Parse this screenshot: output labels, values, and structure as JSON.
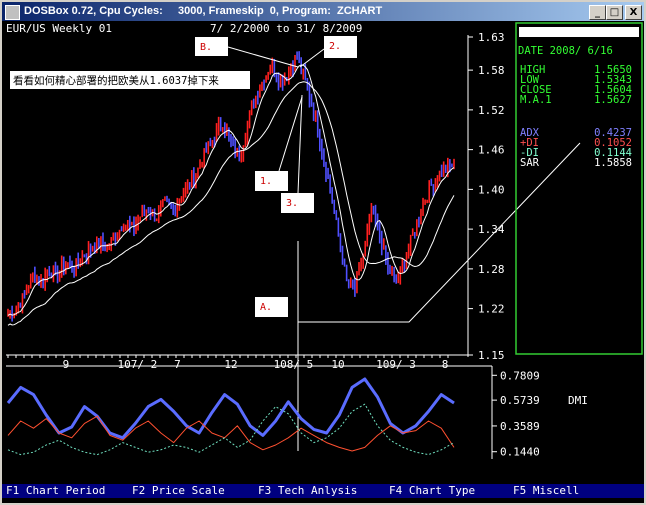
{
  "window": {
    "title": "DOSBox 0.72, Cpu Cycles:     3000, Frameskip  0, Program:  ZCHART",
    "buttons": [
      "_",
      "□",
      "X"
    ]
  },
  "chart_header": {
    "symbol": "EUR/US Weekly 01",
    "range": "7/ 2/2000 to 31/ 8/2009"
  },
  "annotation_cn": "看看如何精心部署的把欧美从1.6037掉下来",
  "labels": {
    "B": "B.",
    "two": "2.",
    "one": "1.",
    "three": "3.",
    "A": "A."
  },
  "info_panel": {
    "date": "DATE 2008/ 6/16",
    "rows": [
      {
        "k": "HIGH",
        "v": "1.5650",
        "color": "#33ff33"
      },
      {
        "k": "LOW",
        "v": "1.5343",
        "color": "#33ff33"
      },
      {
        "k": "CLOSE",
        "v": "1.5604",
        "color": "#33ff33"
      },
      {
        "k": "M.A.1",
        "v": "1.5627",
        "color": "#33ff33"
      }
    ],
    "rows2": [
      {
        "k": "ADX",
        "v": "0.4237",
        "color": "#8080ff"
      },
      {
        "k": "+DI",
        "v": "0.1052",
        "color": "#ff5050"
      },
      {
        "k": "-DI",
        "v": "0.1144",
        "color": "#80ffd0"
      },
      {
        "k": "SAR",
        "v": "1.5858",
        "color": "#ffffff"
      }
    ]
  },
  "dmi_label": "DMI",
  "function_keys": [
    "F1 Chart Period",
    "F2 Price Scale",
    "F3 Tech Anlysis",
    "F4 Chart Type",
    "F5 Miscell"
  ],
  "colors": {
    "up_bar": "#ff2020",
    "down_bar": "#5050ff",
    "ma": "#ffffff",
    "panel_border": "#33cc33"
  },
  "chart_data": [
    {
      "type": "line",
      "title": "EUR/US Weekly 01",
      "y_ticks": [
        "1.63",
        "1.58",
        "1.52",
        "1.46",
        "1.40",
        "1.34",
        "1.28",
        "1.22",
        "1.15"
      ],
      "ylim": [
        1.15,
        1.63
      ],
      "x_ticks": [
        "9",
        "107/ 2",
        "7",
        "12",
        "108/ 5",
        "10",
        "109/ 3",
        "8"
      ],
      "series": [
        {
          "values": [
            1.21,
            1.22,
            1.24,
            1.27,
            1.26,
            1.28,
            1.27,
            1.29,
            1.28,
            1.3,
            1.31,
            1.32,
            1.31,
            1.33,
            1.35,
            1.34,
            1.36,
            1.37,
            1.36,
            1.38,
            1.37,
            1.39,
            1.41,
            1.43,
            1.46,
            1.48,
            1.5,
            1.47,
            1.45,
            1.5,
            1.54,
            1.57,
            1.59,
            1.56,
            1.58,
            1.6,
            1.56,
            1.52,
            1.46,
            1.4,
            1.33,
            1.26,
            1.25,
            1.3,
            1.37,
            1.33,
            1.28,
            1.26,
            1.29,
            1.33,
            1.37,
            1.4,
            1.42,
            1.43,
            1.44
          ]
        }
      ]
    },
    {
      "type": "line",
      "title": "DMI",
      "y_ticks": [
        "0.7809",
        "0.5739",
        "0.3589",
        "0.1440"
      ],
      "ylim": [
        0.1,
        0.8
      ],
      "series": [
        {
          "name": "ADX",
          "values": [
            0.55,
            0.68,
            0.62,
            0.45,
            0.3,
            0.35,
            0.52,
            0.44,
            0.3,
            0.26,
            0.38,
            0.52,
            0.58,
            0.48,
            0.36,
            0.3,
            0.47,
            0.62,
            0.54,
            0.36,
            0.28,
            0.4,
            0.56,
            0.42,
            0.33,
            0.3,
            0.45,
            0.68,
            0.75,
            0.6,
            0.38,
            0.3,
            0.36,
            0.48,
            0.62,
            0.55
          ]
        },
        {
          "name": "+DI",
          "values": [
            0.28,
            0.4,
            0.34,
            0.42,
            0.3,
            0.26,
            0.38,
            0.44,
            0.28,
            0.24,
            0.34,
            0.4,
            0.3,
            0.22,
            0.34,
            0.4,
            0.3,
            0.26,
            0.36,
            0.22,
            0.16,
            0.2,
            0.26,
            0.34,
            0.28,
            0.22,
            0.18,
            0.15,
            0.18,
            0.28,
            0.36,
            0.3,
            0.32,
            0.4,
            0.34,
            0.18
          ]
        },
        {
          "name": "-DI",
          "values": [
            0.16,
            0.12,
            0.14,
            0.2,
            0.24,
            0.18,
            0.14,
            0.12,
            0.16,
            0.22,
            0.18,
            0.14,
            0.16,
            0.2,
            0.18,
            0.14,
            0.2,
            0.26,
            0.18,
            0.24,
            0.4,
            0.52,
            0.46,
            0.3,
            0.22,
            0.26,
            0.34,
            0.48,
            0.54,
            0.36,
            0.24,
            0.18,
            0.14,
            0.12,
            0.16,
            0.22
          ]
        }
      ]
    }
  ]
}
